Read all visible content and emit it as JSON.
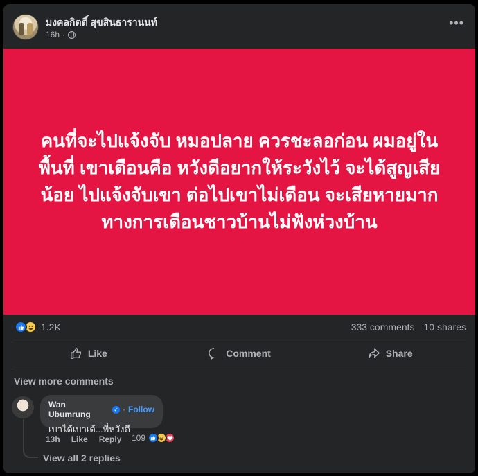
{
  "post": {
    "author": "มงคลกิตติ์ สุขสินธารานนท์",
    "time": "16h",
    "privacy_icon": "globe-icon",
    "more_icon": "more-dots-icon",
    "image_text": "คนที่จะไปแจ้งจับ หมอปลาย ควรชะลอก่อน ผมอยู่ในพื้นที่ เขาเตือนคือ หวังดีอยากให้ระวังไว้ จะได้สูญเสียน้อย ไปแจ้งจับเขา ต่อไปเขาไม่เตือน จะเสียหายมาก ทางการเตือนชาวบ้านไม่ฟังห่วงบ้าน",
    "image_bg_color": "#e41543"
  },
  "stats": {
    "reaction_count": "1.2K",
    "comments": "333 comments",
    "shares": "10 shares"
  },
  "actions": {
    "like": "Like",
    "comment": "Comment",
    "share": "Share"
  },
  "comments": {
    "view_more": "View more comments",
    "items": [
      {
        "name": "Wan Ubumrung",
        "follow": "Follow",
        "text": "เบาได้เบาเด้...พี่หวังดี",
        "time": "13h",
        "like": "Like",
        "reply": "Reply",
        "reaction_count": "109"
      }
    ],
    "view_replies": "View all 2 replies"
  },
  "colors": {
    "card_bg": "#242526",
    "accent_blue": "#1877f2",
    "link_blue": "#4599ff",
    "muted_text": "#b0b3b8"
  }
}
